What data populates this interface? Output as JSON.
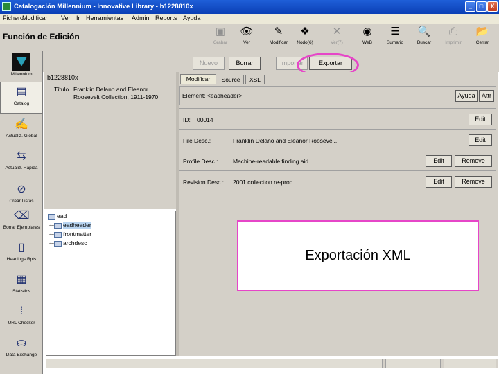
{
  "window": {
    "title": "Catalogación Millennium - Innovative Library - b1228810x",
    "minimize": "_",
    "maximize": "□",
    "close": "X"
  },
  "menu": [
    "Fichero",
    "Modificar",
    "Ver",
    "Ir",
    "Herramientas",
    "Admin",
    "Reports",
    "Ayuda"
  ],
  "toolbar": {
    "heading": "Función de Edición",
    "tools": [
      {
        "label": "Grabar",
        "icon": "save-icon",
        "glyph": "▣",
        "disabled": true
      },
      {
        "label": "Ver",
        "icon": "view-icon",
        "glyph": "👁",
        "disabled": false
      },
      {
        "label": "Modificar",
        "icon": "edit-icon",
        "glyph": "✎",
        "disabled": false
      },
      {
        "label": "Nodo(6)",
        "icon": "node-icon",
        "glyph": "❖",
        "disabled": false
      },
      {
        "label": "Ver(7)",
        "icon": "tools-icon",
        "glyph": "✕",
        "disabled": true
      },
      {
        "label": "WeB",
        "icon": "web-icon",
        "glyph": "◉",
        "disabled": false
      },
      {
        "label": "Sumario",
        "icon": "summary-icon",
        "glyph": "☰",
        "disabled": false
      },
      {
        "label": "Buscar",
        "icon": "search-icon",
        "glyph": "🔍",
        "disabled": false
      },
      {
        "label": "Imprimir",
        "icon": "print-icon",
        "glyph": "⎙",
        "disabled": true
      },
      {
        "label": "Cerrar",
        "icon": "close-folder-icon",
        "glyph": "📂",
        "disabled": false
      }
    ]
  },
  "actions": {
    "new": "Nuevo",
    "delete": "Borrar",
    "import": "Importar",
    "export": "Exportar"
  },
  "nav": [
    {
      "label": "Millennium",
      "icon": "millennium-logo-icon"
    },
    {
      "label": "Catalog",
      "icon": "catalog-icon",
      "glyph": "▤"
    },
    {
      "label": "Actualiz. Global",
      "icon": "global-update-icon",
      "glyph": "✍"
    },
    {
      "label": "Actualiz. Rápida",
      "icon": "rapid-update-icon",
      "glyph": "⇆"
    },
    {
      "label": "Crear Listas",
      "icon": "create-lists-icon",
      "glyph": "⊘"
    },
    {
      "label": "Borrar Ejemplares",
      "icon": "delete-items-icon",
      "glyph": "⌫"
    },
    {
      "label": "Headings Rpts",
      "icon": "headings-icon",
      "glyph": "▯"
    },
    {
      "label": "Statistics",
      "icon": "statistics-icon",
      "glyph": "▦"
    },
    {
      "label": "URL Checker",
      "icon": "url-checker-icon",
      "glyph": "⁞"
    },
    {
      "label": "Data Exchange",
      "icon": "data-exchange-icon",
      "glyph": "⛀"
    }
  ],
  "record": {
    "number": "b1228810x",
    "title_label": "Título",
    "title_value": "Franklin Delano and Eleanor Roosevelt Collection, 1911-1970"
  },
  "tree": [
    {
      "label": "ead",
      "indent": 0,
      "selected": false
    },
    {
      "label": "eadheader",
      "indent": 1,
      "selected": true
    },
    {
      "label": "frontmatter",
      "indent": 1,
      "selected": false
    },
    {
      "label": "archdesc",
      "indent": 1,
      "selected": false
    }
  ],
  "editor": {
    "tabs": [
      "Modificar",
      "Source",
      "XSL"
    ],
    "element_label": "Element: <eadheader>",
    "help_button": "Ayuda",
    "attr_button": "Attr",
    "fields": [
      {
        "label": "ID:",
        "value": "00014",
        "buttons": [
          "Edit"
        ]
      },
      {
        "label": "File Desc.:",
        "value": "Franklin Delano and Eleanor Roosevel...",
        "buttons": [
          "Edit"
        ]
      },
      {
        "label": "Profile Desc.:",
        "value": "Machine-readable finding aid ...",
        "buttons": [
          "Edit",
          "Remove"
        ]
      },
      {
        "label": "Revision Desc.:",
        "value": "2001          collection re-proc...",
        "buttons": [
          "Edit",
          "Remove"
        ]
      }
    ]
  },
  "callout": {
    "text": "Exportación XML"
  },
  "colors": {
    "highlight": "#e646c8",
    "titlebar": "#0a3fb5",
    "chrome": "#d4d0c8"
  }
}
